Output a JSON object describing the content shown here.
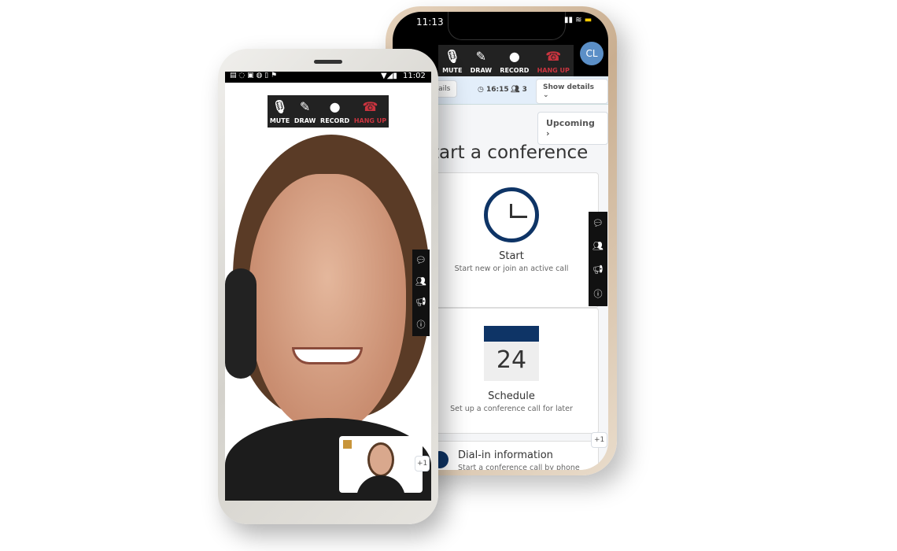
{
  "back_phone": {
    "status_time": "11:13",
    "toolbar": [
      {
        "icon": "mic-icon",
        "label": "MUTE"
      },
      {
        "icon": "pencil-icon",
        "label": "DRAW"
      },
      {
        "icon": "record-icon",
        "label": "RECORD"
      },
      {
        "icon": "phone-hangup-icon",
        "label": "HANG UP"
      }
    ],
    "avatar": "CL",
    "info": {
      "details_left": "etails",
      "time": "16:15",
      "participants": "3",
      "show_details": "Show details"
    },
    "upcoming": "Upcoming",
    "title": "tart a conference",
    "start": {
      "title": "Start",
      "subtitle": "Start new or join an active call"
    },
    "schedule": {
      "day": "24",
      "title": "Schedule",
      "subtitle": "Set up a conference call for later"
    },
    "dialin": {
      "title": "Dial-in information",
      "subtitle": "Start a conference call by phone"
    },
    "extra_count": "+1"
  },
  "front_phone": {
    "status_time": "11:02",
    "toolbar": [
      {
        "icon": "mic-icon",
        "label": "MUTE"
      },
      {
        "icon": "pencil-icon",
        "label": "DRAW"
      },
      {
        "icon": "record-icon",
        "label": "RECORD"
      },
      {
        "icon": "phone-hangup-icon",
        "label": "HANG UP"
      }
    ],
    "extra_count": "+1"
  },
  "colors": {
    "hangup": "#c9343f",
    "avatar": "#5b8fc7",
    "calendar": "#0e3466",
    "clock": "#0e3466"
  }
}
